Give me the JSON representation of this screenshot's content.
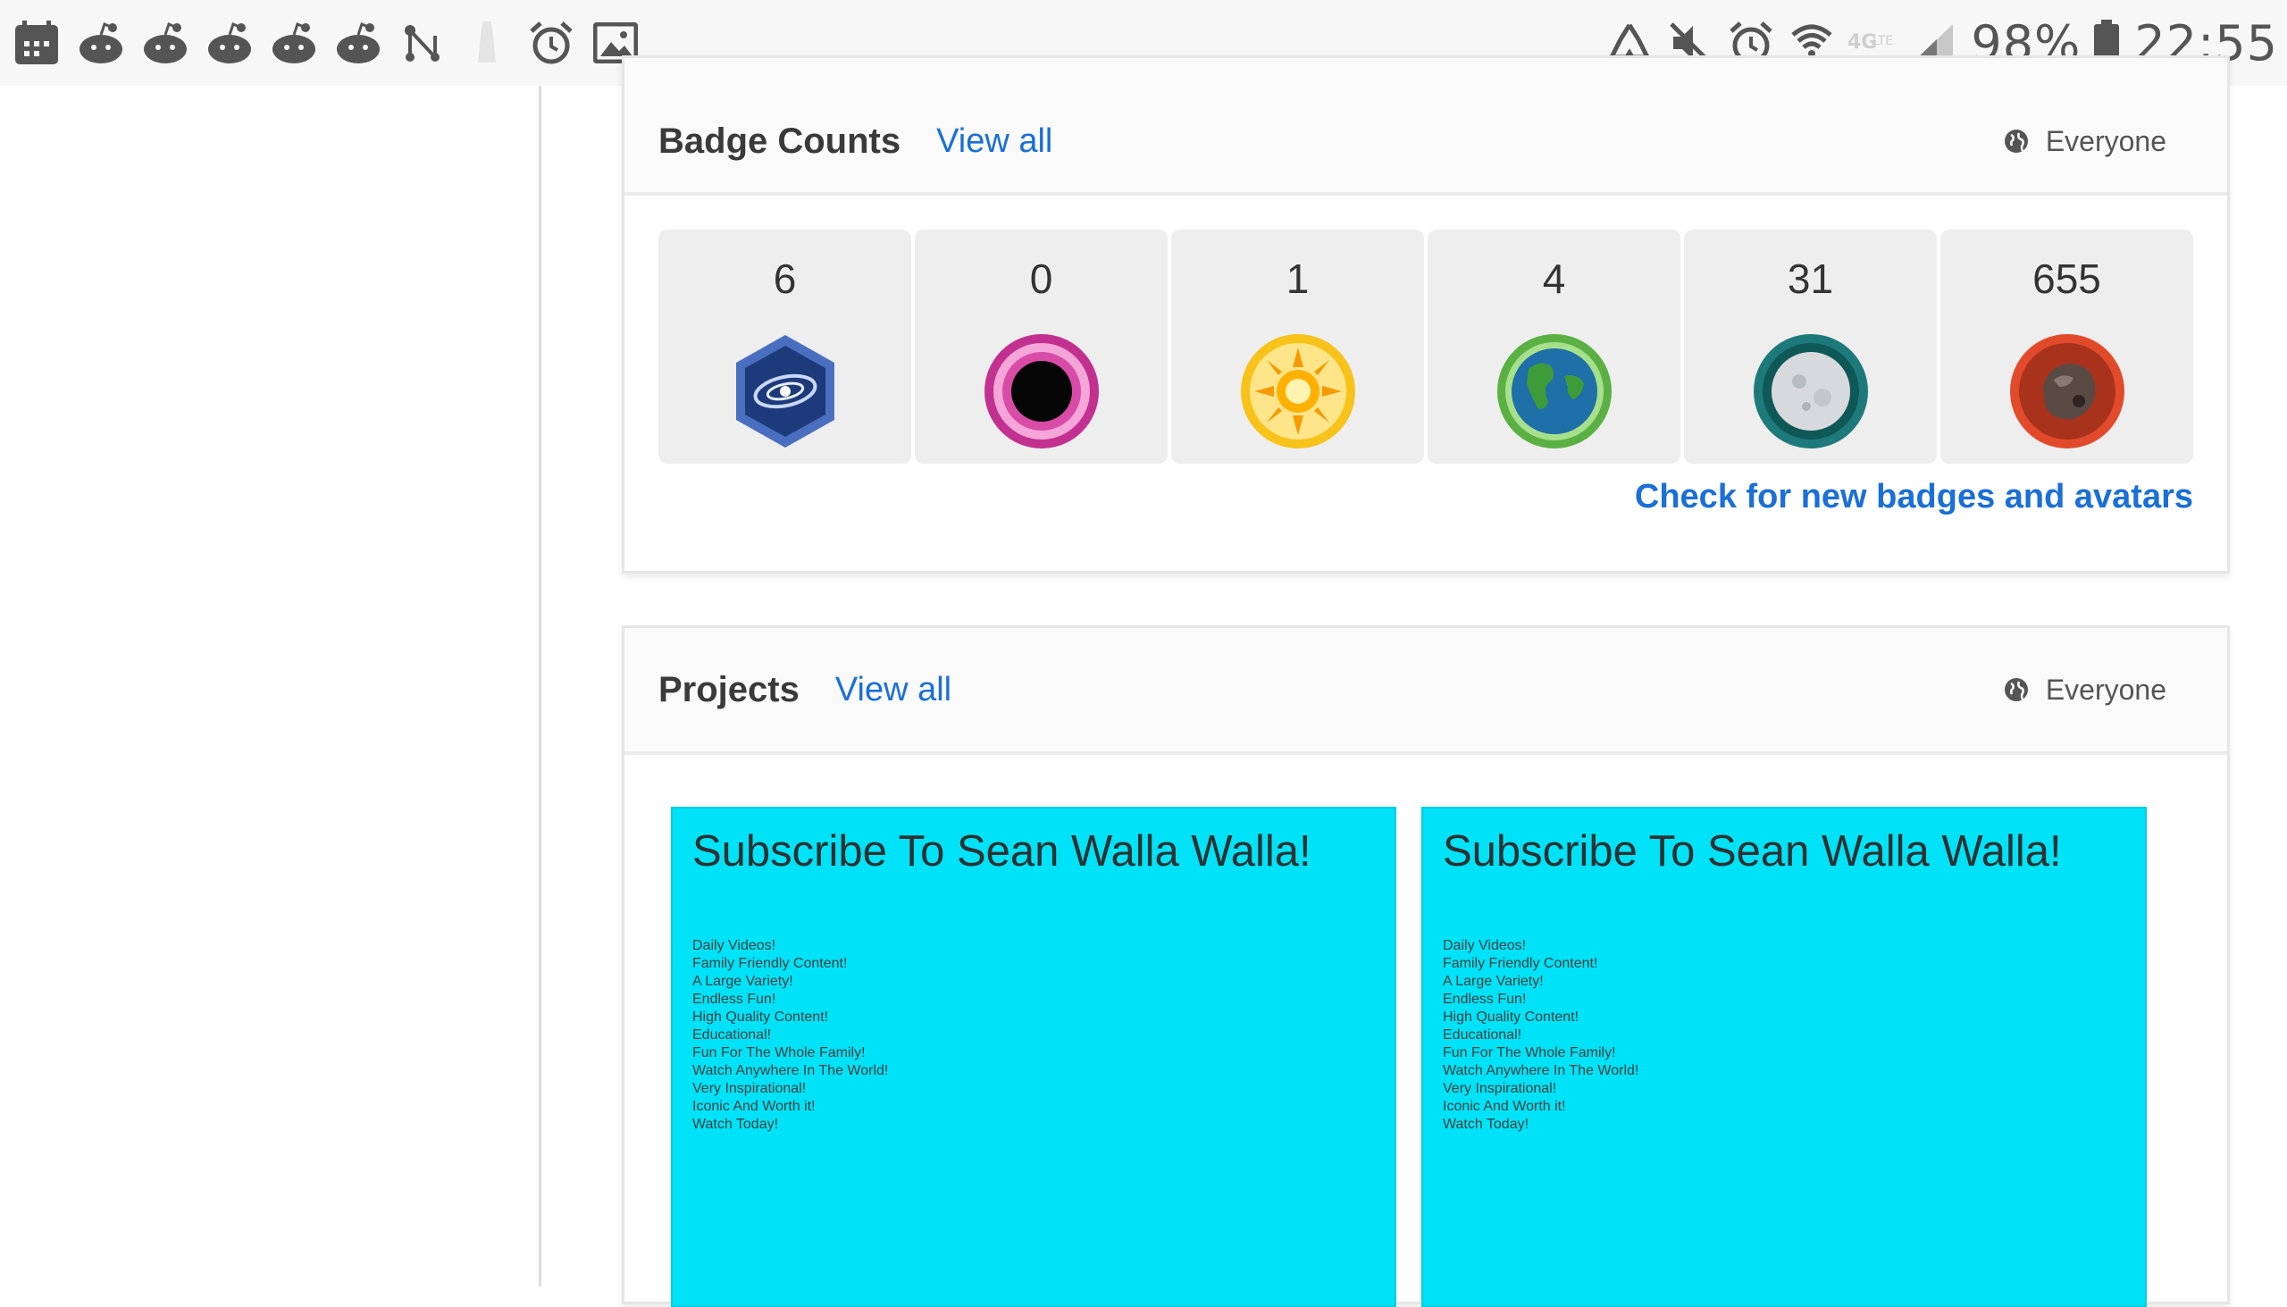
{
  "status_bar": {
    "left_icons": [
      "calendar-icon",
      "reddit-icon",
      "reddit-icon",
      "reddit-icon",
      "reddit-icon",
      "reddit-icon",
      "nodes-icon",
      "lighthouse-icon",
      "alarm-icon",
      "image-icon"
    ],
    "right_icons": [
      "recycle-icon",
      "mute-icon",
      "alarm-icon",
      "wifi-icon",
      "lte-icon",
      "signal-icon"
    ],
    "battery_percent": "98%",
    "time": "22:55",
    "color": "#555555"
  },
  "badge_counts": {
    "title": "Badge Counts",
    "view_all": "View all",
    "privacy": "Everyone",
    "badges": [
      {
        "count": "6",
        "icon": "galaxy-badge-icon",
        "color": "#3d5fa8"
      },
      {
        "count": "0",
        "icon": "black-hole-badge-icon",
        "color": "#c2318f"
      },
      {
        "count": "1",
        "icon": "sun-badge-icon",
        "color": "#f5b400"
      },
      {
        "count": "4",
        "icon": "earth-badge-icon",
        "color": "#5bb043"
      },
      {
        "count": "31",
        "icon": "moon-badge-icon",
        "color": "#1e7a7a"
      },
      {
        "count": "655",
        "icon": "asteroid-badge-icon",
        "color": "#d94a2b"
      }
    ],
    "check_link": "Check for new badges and avatars"
  },
  "projects": {
    "title": "Projects",
    "view_all": "View all",
    "privacy": "Everyone",
    "items": [
      {
        "title": "Subscribe To Sean Walla Walla!",
        "lines": [
          "Daily Videos!",
          "Family Friendly Content!",
          "A Large Variety!",
          "Endless Fun!",
          "High Quality Content!",
          "Educational!",
          "Fun For The Whole Family!",
          "Watch Anywhere In The World!",
          "Very Inspirational!",
          "Iconic And Worth it!",
          "Watch Today!"
        ]
      },
      {
        "title": "Subscribe To Sean Walla Walla!",
        "lines": [
          "Daily Videos!",
          "Family Friendly Content!",
          "A Large Variety!",
          "Endless Fun!",
          "High Quality Content!",
          "Educational!",
          "Fun For The Whole Family!",
          "Watch Anywhere In The World!",
          "Very Inspirational!",
          "Iconic And Worth it!",
          "Watch Today!"
        ]
      }
    ],
    "thumb_color": "#00e2f7"
  },
  "colors": {
    "link": "#1a6fd8",
    "badge_tile": "#eeeeee"
  }
}
